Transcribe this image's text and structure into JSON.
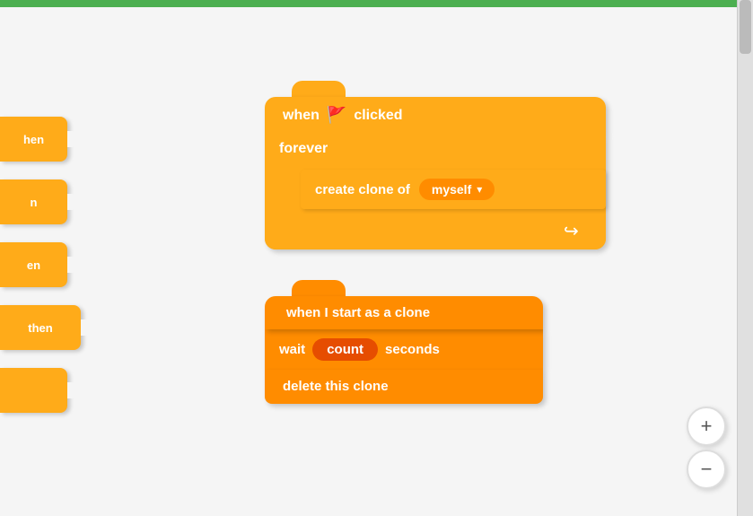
{
  "top_bar": {
    "color": "#4CAF50"
  },
  "sidebar_blocks": [
    {
      "label": "hen",
      "id": "block1"
    },
    {
      "label": "n",
      "id": "block2"
    },
    {
      "label": "en",
      "id": "block3"
    },
    {
      "label": "then",
      "id": "block4"
    },
    {
      "label": "",
      "id": "block5"
    }
  ],
  "when_clicked_stack": {
    "hat_block": {
      "when_text": "when",
      "flag": "🚩",
      "clicked_text": "clicked"
    },
    "forever_block": {
      "label": "forever"
    },
    "create_clone_block": {
      "label": "create clone of",
      "dropdown": {
        "value": "myself",
        "arrow": "▾"
      }
    },
    "loop_arrow": "↩"
  },
  "clone_stack": {
    "hat_block": {
      "label": "when I start as a clone"
    },
    "wait_block": {
      "wait_text": "wait",
      "count_label": "count",
      "seconds_text": "seconds"
    },
    "delete_block": {
      "label": "delete this clone"
    }
  },
  "zoom_controls": {
    "zoom_in_label": "+",
    "zoom_out_label": "−"
  }
}
